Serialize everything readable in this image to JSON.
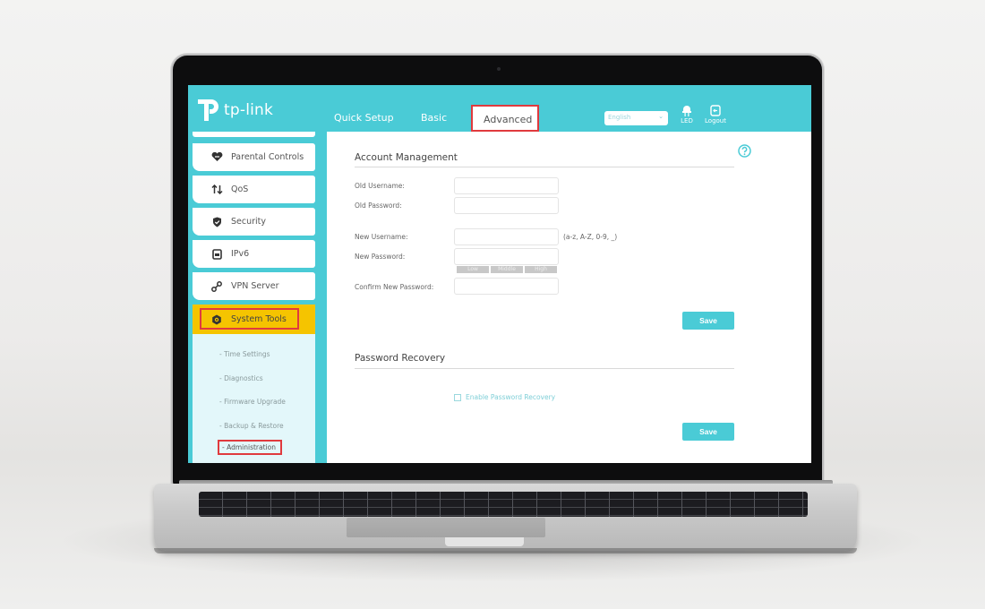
{
  "brand": {
    "logo_text": "tp-link",
    "accent_color": "#4acbd6",
    "highlight_color": "#f5c400",
    "annotation_color": "#e03a3e"
  },
  "top_nav": {
    "tabs": [
      {
        "label": "Quick Setup",
        "active": false
      },
      {
        "label": "Basic",
        "active": false
      },
      {
        "label": "Advanced",
        "active": true
      }
    ],
    "language_select": {
      "value": "English",
      "icon": "chevron-down-icon"
    },
    "led": {
      "label": "LED",
      "icon": "led-icon"
    },
    "logout": {
      "label": "Logout",
      "icon": "logout-icon"
    }
  },
  "sidebar": {
    "items": [
      {
        "label": "Parental Controls",
        "icon": "heart-hands-icon"
      },
      {
        "label": "QoS",
        "icon": "up-down-arrows-icon"
      },
      {
        "label": "Security",
        "icon": "shield-check-icon"
      },
      {
        "label": "IPv6",
        "icon": "ipv6-document-icon"
      },
      {
        "label": "VPN Server",
        "icon": "link-icon"
      }
    ],
    "active_item": {
      "label": "System Tools",
      "icon": "gear-icon"
    },
    "submenu": [
      {
        "label": "- Time Settings",
        "active": false
      },
      {
        "label": "- Diagnostics",
        "active": false
      },
      {
        "label": "- Firmware Upgrade",
        "active": false
      },
      {
        "label": "- Backup & Restore",
        "active": false
      },
      {
        "label": "- Administration",
        "active": true
      }
    ]
  },
  "account_management": {
    "title": "Account Management",
    "help_icon": "question-circle-icon",
    "fields": {
      "old_username": {
        "label": "Old Username:",
        "value": ""
      },
      "old_password": {
        "label": "Old Password:",
        "value": ""
      },
      "new_username": {
        "label": "New Username:",
        "value": "",
        "hint": "(a-z, A-Z, 0-9, _)"
      },
      "new_password": {
        "label": "New Password:",
        "value": ""
      },
      "confirm_password": {
        "label": "Confirm New Password:",
        "value": ""
      }
    },
    "strength_levels": [
      "Low",
      "Middle",
      "High"
    ],
    "save_label": "Save"
  },
  "password_recovery": {
    "title": "Password Recovery",
    "checkbox_label": "Enable Password Recovery",
    "checked": false,
    "save_label": "Save"
  }
}
